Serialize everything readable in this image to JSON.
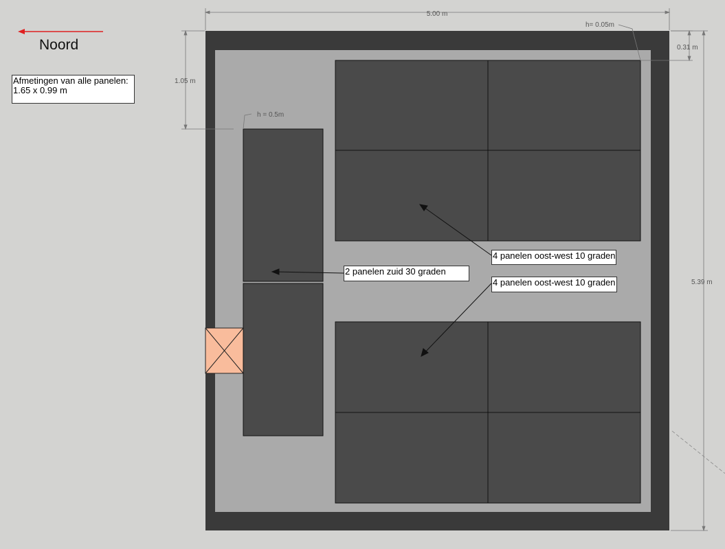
{
  "north": {
    "label": "Noord",
    "arrow_color": "#e02020"
  },
  "info_box": {
    "line1": "Afmetingen van alle panelen:",
    "line2": "1.65 x 0.99 m"
  },
  "dimensions": {
    "width": "5.00 m",
    "height": "5.39 m",
    "edge_offset": "1.05 m",
    "edge_width": "0.31 m",
    "edge_height": "h= 0.05m",
    "south_group_height": "h = 0.5m"
  },
  "labels": {
    "south_panels": "2 panelen zuid 30 graden",
    "east_west_top": "4 panelen oost-west 10 graden",
    "east_west_bottom": "4 panelen oost-west 10 graden"
  },
  "colors": {
    "background": "#d3d3d1",
    "roof_edge": "#3a3a3a",
    "roof_surface": "#aaaaaa",
    "panel": "#4a4a4a",
    "hatch": "#f9bc9c"
  }
}
